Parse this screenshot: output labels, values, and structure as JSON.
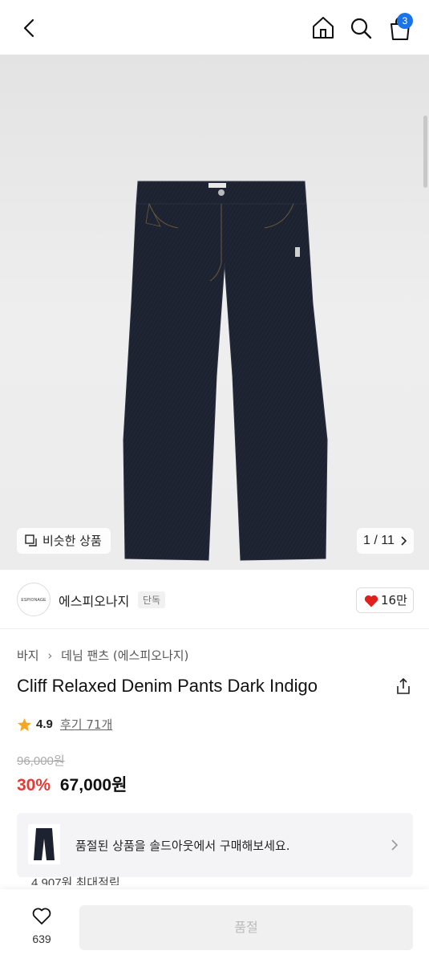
{
  "header": {
    "cart_count": "3"
  },
  "gallery": {
    "similar_label": "비슷한 상품",
    "pager": "1 / 11"
  },
  "brand": {
    "logo_text": "ESPIONAGE",
    "name": "에스피오나지",
    "tag": "단독",
    "likes": "16만"
  },
  "product": {
    "breadcrumb": [
      "바지",
      "데님 팬츠 (에스피오나지)"
    ],
    "title": "Cliff Relaxed Denim Pants Dark Indigo",
    "rating": "4.9",
    "reviews": "후기 71개",
    "original_price": "96,000원",
    "discount": "30%",
    "price": "67,000원"
  },
  "soldout": {
    "message": "품절된 상품을 솔드아웃에서 구매해보세요."
  },
  "points": "4,907원 최대적립",
  "bottom": {
    "wish_count": "639",
    "buy_label": "품절"
  },
  "colors": {
    "accent_badge": "#1a73e8",
    "discount": "#e53935",
    "heart": "#e0201f",
    "star": "#f5a623",
    "denim": "#1d2230"
  }
}
